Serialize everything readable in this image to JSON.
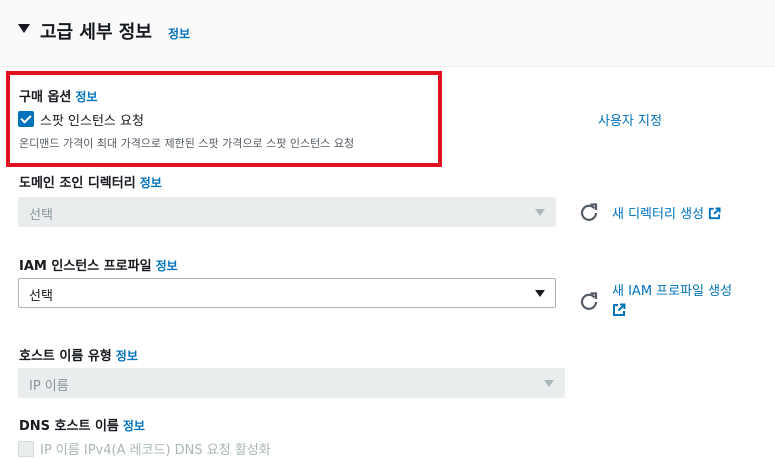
{
  "section": {
    "title": "고급 세부 정보",
    "info": "정보"
  },
  "purchase": {
    "label": "구매 옵션",
    "info": "정보",
    "spot_label": "스팟 인스턴스 요청",
    "spot_checked": true,
    "spot_desc": "온디맨드 가격이 최대 가격으로 제한된 스팟 가격으로 스팟 인스턴스 요청",
    "customize": "사용자 지정"
  },
  "domain_join": {
    "label": "도메인 조인 디렉터리",
    "info": "정보",
    "value": "선택",
    "create_link": "새 디렉터리 생성"
  },
  "iam_profile": {
    "label": "IAM 인스턴스 프로파일",
    "info": "정보",
    "value": "선택",
    "create_link": "새 IAM 프로파일 생성"
  },
  "hostname_type": {
    "label": "호스트 이름 유형",
    "info": "정보",
    "value": "IP 이름"
  },
  "dns_hostname": {
    "label": "DNS 호스트 이름",
    "info": "정보",
    "option": "IP 이름 IPv4(A 레코드) DNS 요청 활성화"
  },
  "colors": {
    "link": "#0073bb",
    "highlight": "#e0101f",
    "checkbox": "#0073bb"
  }
}
